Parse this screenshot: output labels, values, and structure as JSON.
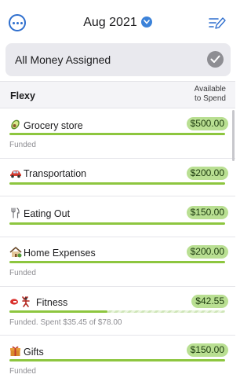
{
  "header": {
    "month": "Aug 2021",
    "more_icon": "ellipsis-circle-icon",
    "chevron_icon": "chevron-down-icon",
    "edit_icon": "edit-list-icon",
    "accent": "#2f6fce"
  },
  "banner": {
    "text": "All Money Assigned",
    "check_icon": "check-circle-icon"
  },
  "group": {
    "name": "Flexy",
    "available_line1": "Available",
    "available_line2": "to Spend"
  },
  "categories": [
    {
      "name": "Grocery store",
      "icon": "avocado-icon",
      "amount": "$500.00",
      "status": "Funded",
      "progress": 1.0
    },
    {
      "name": "Transportation",
      "icon": "car-icon",
      "amount": "$200.00",
      "status": "",
      "progress": 1.0
    },
    {
      "name": "Eating Out",
      "icon": "fork-knife-icon",
      "amount": "$150.00",
      "status": "",
      "progress": 1.0
    },
    {
      "name": "Home Expenses",
      "icon": "house-icon",
      "amount": "$200.00",
      "status": "Funded",
      "progress": 1.0
    },
    {
      "name": "Fitness",
      "icon": "dumbbell-icon",
      "amount": "$42.55",
      "status": "Funded. Spent $35.45 of $78.00",
      "progress": 0.455
    },
    {
      "name": "Gifts",
      "icon": "gift-icon",
      "amount": "$150.00",
      "status": "Funded",
      "progress": 1.0
    }
  ],
  "colors": {
    "amount_pill": "#b9df92",
    "progress": "#8dc63f",
    "banner_bg": "#e9e9ee"
  }
}
